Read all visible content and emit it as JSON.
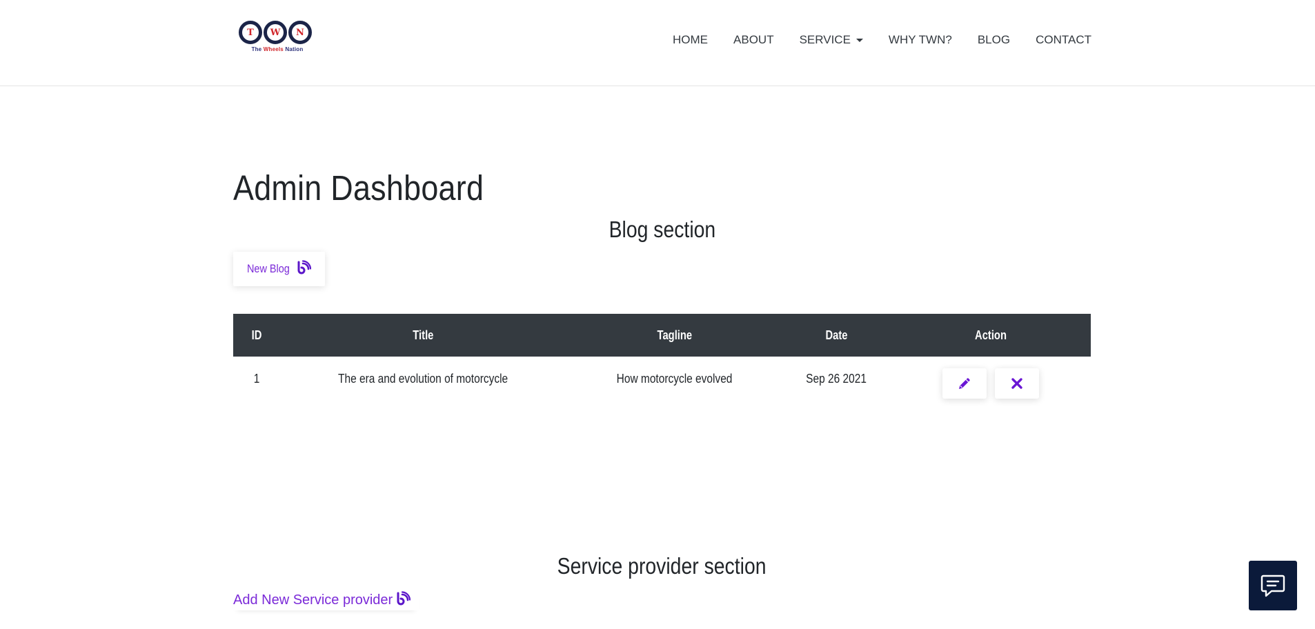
{
  "header": {
    "logo": {
      "letters": [
        "T",
        "W",
        "N"
      ],
      "tagline_prefix": "The ",
      "tagline_wheels": "Wheels",
      "tagline_suffix": " Nation"
    },
    "nav": [
      {
        "label": "HOME"
      },
      {
        "label": "ABOUT"
      },
      {
        "label": "SERVICE"
      },
      {
        "label": "WHY TWN?"
      },
      {
        "label": "BLOG"
      },
      {
        "label": "CONTACT"
      }
    ]
  },
  "main": {
    "title": "Admin Dashboard",
    "blog_section": {
      "heading": "Blog section",
      "new_button_label": "New Blog",
      "columns": [
        "ID",
        "Title",
        "Tagline",
        "Date",
        "Action"
      ],
      "rows": [
        {
          "id": "1",
          "title": "The era and evolution of motorcycle",
          "tagline": "How motorcycle evolved",
          "date": "Sep 26 2021"
        }
      ]
    },
    "service_section": {
      "heading": "Service provider section",
      "add_link_label": "Add New Service provider"
    }
  },
  "icons": {
    "blog": "blog-icon",
    "edit": "pencil-icon",
    "delete": "close-icon",
    "chat": "chat-icon",
    "dropdown": "caret-down-icon"
  },
  "colors": {
    "accent": "#7b2ad8",
    "icon_purple": "#6a16d4",
    "table_header": "#343a40",
    "chat_bg": "#0b1a3a",
    "logo_red": "#d0262b",
    "logo_navy": "#1b2448"
  }
}
